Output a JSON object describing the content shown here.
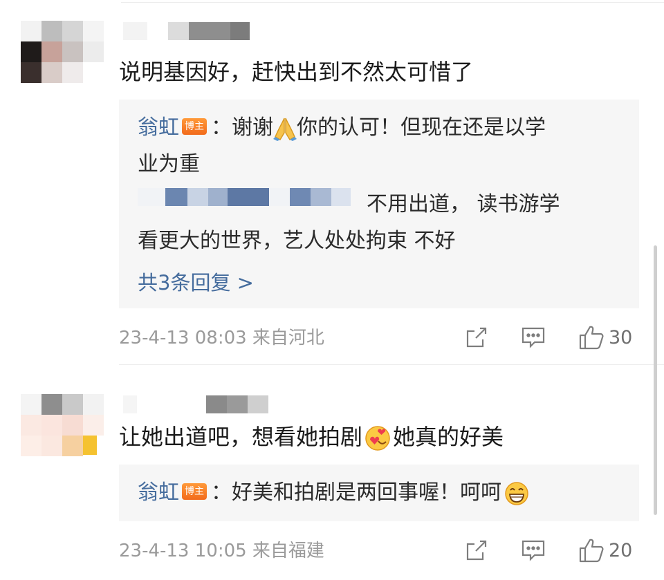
{
  "comments": [
    {
      "text": "说明基因好，赶快出到不然太可惜了",
      "reply": {
        "author": "翁虹",
        "badge": "博主",
        "line1": "：谢谢",
        "line1b": "你的认可！但现在还是以学",
        "line2": "业为重",
        "line3": "不用出道， 读书游学",
        "line4": "看更大的世界，艺人处处拘束 不好"
      },
      "more_replies": "共3条回复 >",
      "timestamp": "23-4-13 08:03 来自河北",
      "likes": "30",
      "emoji": "pray-emoji"
    },
    {
      "text_a": "让她出道吧，想看她拍剧",
      "text_b": "她真的好美",
      "reply": {
        "author": "翁虹",
        "badge": "博主",
        "text": "：好美和拍剧是两回事喔！呵呵"
      },
      "timestamp": "23-4-13 10:05 来自福建",
      "likes": "20",
      "emoji": "heart-face-emoji"
    }
  ],
  "icons": {
    "share": "share-icon",
    "comment": "comment-icon",
    "like": "like-icon"
  },
  "colors": {
    "author": "#456c9d",
    "badge": "#f26a1b",
    "reply_bg": "#f6f6f6",
    "meta": "#9a9a9a"
  }
}
